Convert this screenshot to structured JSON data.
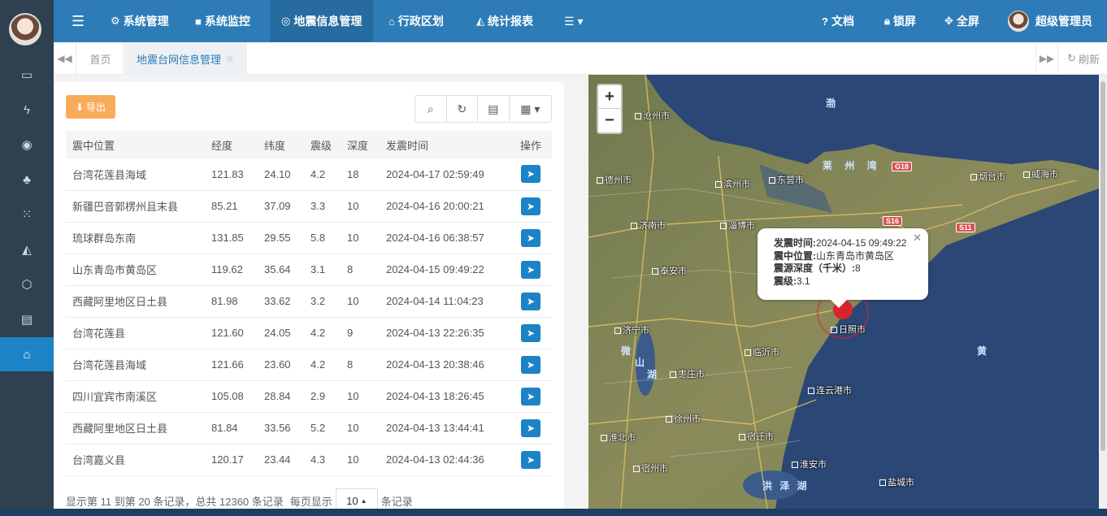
{
  "topnav": {
    "items": [
      {
        "icon": "menu-icon",
        "label": ""
      },
      {
        "icon": "gear-icon",
        "label": "系统管理"
      },
      {
        "icon": "video-icon",
        "label": "系统监控"
      },
      {
        "icon": "map-marker-icon",
        "label": "地震信息管理"
      },
      {
        "icon": "bank-icon",
        "label": "行政区划"
      },
      {
        "icon": "chart-icon",
        "label": "统计报表"
      },
      {
        "icon": "list-dropdown-icon",
        "label": ""
      }
    ],
    "right": {
      "docs": "文档",
      "lock": "锁屏",
      "fullscreen": "全屏",
      "user": "超级管理员"
    }
  },
  "tabs": {
    "home": "首页",
    "current": "地震台网信息管理",
    "refresh": "刷新"
  },
  "toolbar": {
    "export": "导出"
  },
  "table": {
    "headers": [
      "震中位置",
      "经度",
      "纬度",
      "震级",
      "深度",
      "发震时间",
      "操作"
    ],
    "rows": [
      [
        "台湾花莲县海域",
        "121.83",
        "24.10",
        "4.2",
        "18",
        "2024-04-17 02:59:49"
      ],
      [
        "新疆巴音郭楞州且末县",
        "85.21",
        "37.09",
        "3.3",
        "10",
        "2024-04-16 20:00:21"
      ],
      [
        "琉球群岛东南",
        "131.85",
        "29.55",
        "5.8",
        "10",
        "2024-04-16 06:38:57"
      ],
      [
        "山东青岛市黄岛区",
        "119.62",
        "35.64",
        "3.1",
        "8",
        "2024-04-15 09:49:22"
      ],
      [
        "西藏阿里地区日土县",
        "81.98",
        "33.62",
        "3.2",
        "10",
        "2024-04-14 11:04:23"
      ],
      [
        "台湾花莲县",
        "121.60",
        "24.05",
        "4.2",
        "9",
        "2024-04-13 22:26:35"
      ],
      [
        "台湾花莲县海域",
        "121.66",
        "23.60",
        "4.2",
        "8",
        "2024-04-13 20:38:46"
      ],
      [
        "四川宜宾市南溪区",
        "105.08",
        "28.84",
        "2.9",
        "10",
        "2024-04-13 18:26:45"
      ],
      [
        "西藏阿里地区日土县",
        "81.84",
        "33.56",
        "5.2",
        "10",
        "2024-04-13 13:44:41"
      ],
      [
        "台湾嘉义县",
        "120.17",
        "23.44",
        "4.3",
        "10",
        "2024-04-13 02:44:36"
      ]
    ]
  },
  "pager": {
    "summary": "显示第 11 到第 20 条记录，总共 12360 条记录",
    "per_page_label": "每页显示",
    "page_size": "10",
    "suffix": "条记录"
  },
  "map": {
    "popup": {
      "time_label": "发震时间:",
      "time": "2024-04-15 09:49:22",
      "loc_label": "震中位置:",
      "loc": "山东青岛市黄岛区",
      "depth_label": "震源深度（千米）:",
      "depth": "8",
      "mag_label": "震级:",
      "mag": "3.1"
    },
    "cities": [
      "沧州市",
      "德州市",
      "滨州市",
      "东营市",
      "烟台市",
      "威海市",
      "济南市",
      "淄博市",
      "泰安市",
      "济宁市",
      "临沂市",
      "枣庄市",
      "日照市",
      "连云港市",
      "徐州市",
      "宿迁市",
      "淮北市",
      "宿州市",
      "淮安市",
      "盐城市"
    ],
    "seas": [
      "渤",
      "莱 州 湾",
      "黄",
      "微",
      "山",
      "湖",
      "洪 泽 湖"
    ],
    "roads": [
      "G18",
      "S16",
      "S11"
    ]
  }
}
